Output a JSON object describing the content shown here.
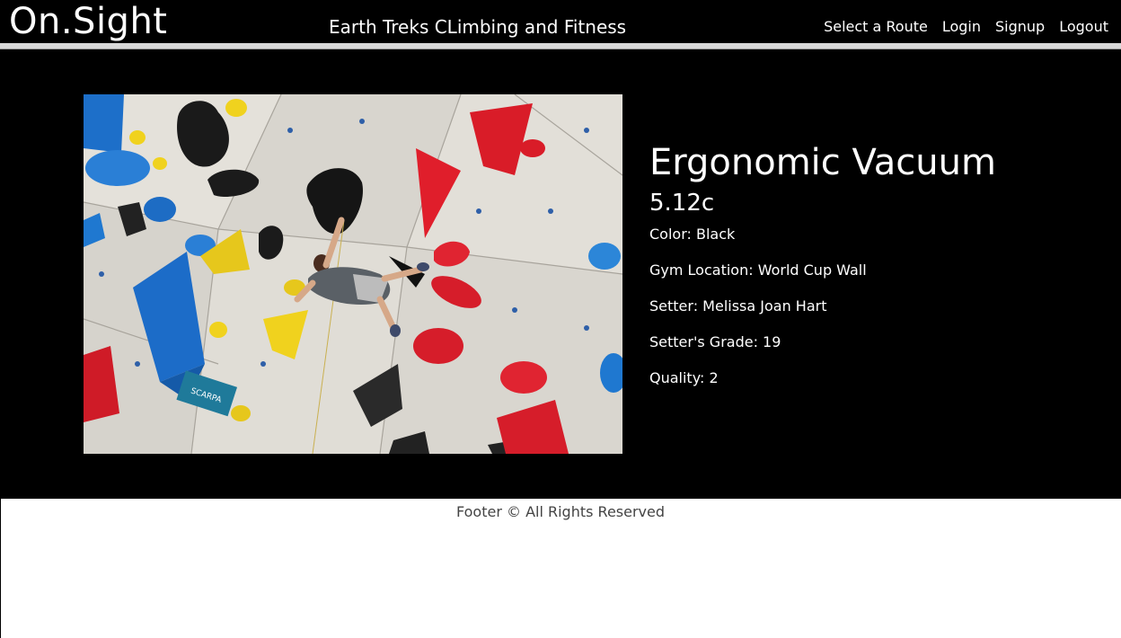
{
  "navbar": {
    "brand": "On.Sight",
    "gym_name": "Earth Treks CLimbing and Fitness",
    "links": [
      "Select a Route",
      "Login",
      "Signup",
      "Logout"
    ]
  },
  "route": {
    "name": "Ergonomic Vacuum",
    "grade": "5.12c",
    "color": "Color: Black",
    "location": "Gym Location: World Cup Wall",
    "setter": "Setter: Melissa Joan Hart",
    "setter_grade": "Setter's Grade: 19",
    "quality": "Quality: 2",
    "photo_sign_text": "SCARPA"
  },
  "footer": {
    "text": "Footer © All Rights Reserved"
  },
  "colors": {
    "navbar_bg": "#000000",
    "main_bg": "#000000",
    "page_bg": "#ffffff",
    "text_light": "#ffffff",
    "footer_text": "#444444"
  }
}
